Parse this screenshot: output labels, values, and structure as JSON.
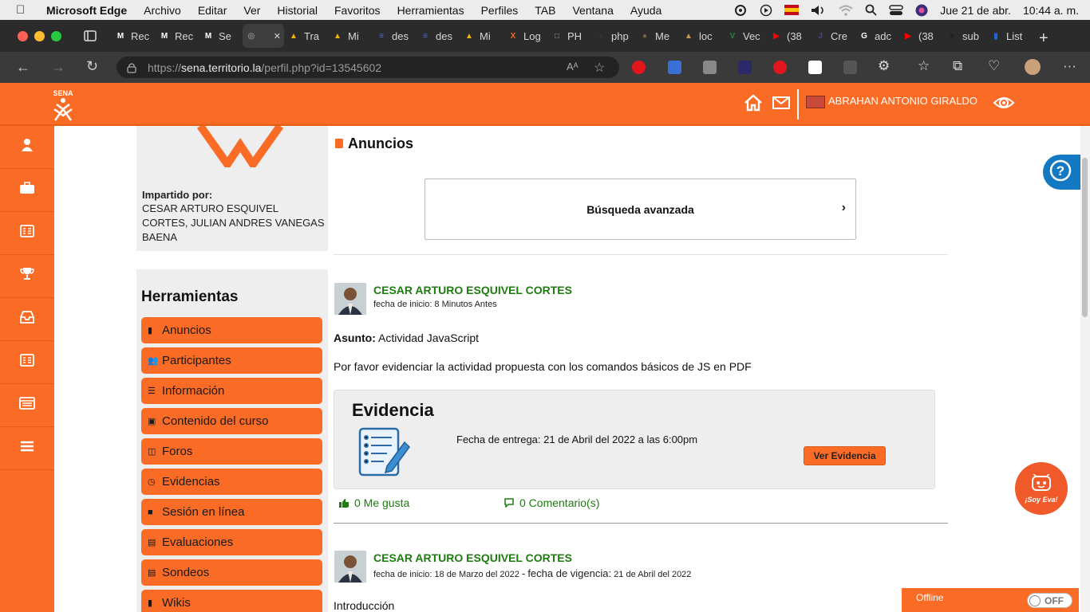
{
  "macbar": {
    "app": "Microsoft Edge",
    "menus": [
      "Archivo",
      "Editar",
      "Ver",
      "Historial",
      "Favoritos",
      "Herramientas",
      "Perfiles",
      "TAB",
      "Ventana",
      "Ayuda"
    ],
    "date": "Jue 21 de abr.",
    "time": "10:44 a. m."
  },
  "tabs": [
    {
      "label": "Rec",
      "color": "#ffffff",
      "glyph": "M"
    },
    {
      "label": "Rec",
      "color": "#ffffff",
      "glyph": "M"
    },
    {
      "label": "Se",
      "color": "#ffffff",
      "glyph": "M"
    },
    {
      "label": "",
      "color": "#888888",
      "glyph": "◎"
    },
    {
      "label": "Tra",
      "color": "#f4b400",
      "glyph": "▲"
    },
    {
      "label": "Mi",
      "color": "#f4b400",
      "glyph": "▲"
    },
    {
      "label": "des",
      "color": "#4a6fd6",
      "glyph": "≡"
    },
    {
      "label": "des",
      "color": "#4a6fd6",
      "glyph": "≡"
    },
    {
      "label": "Mi",
      "color": "#f4b400",
      "glyph": "▲"
    },
    {
      "label": "Log",
      "color": "#f26522",
      "glyph": "X"
    },
    {
      "label": "PH",
      "color": "#999999",
      "glyph": "□"
    },
    {
      "label": "php",
      "color": "#333333",
      "glyph": "●"
    },
    {
      "label": "Me",
      "color": "#776a43",
      "glyph": "●"
    },
    {
      "label": "loc",
      "color": "#c6a14a",
      "glyph": "▲"
    },
    {
      "label": "Vec",
      "color": "#2f7d3c",
      "glyph": "V"
    },
    {
      "label": "(38",
      "color": "#ff0000",
      "glyph": "▶"
    },
    {
      "label": "Cre",
      "color": "#5b3b8c",
      "glyph": "J"
    },
    {
      "label": "adc",
      "color": "#ffffff",
      "glyph": "G"
    },
    {
      "label": "(38",
      "color": "#ff0000",
      "glyph": "▶"
    },
    {
      "label": "sub",
      "color": "#222222",
      "glyph": "●"
    },
    {
      "label": "List",
      "color": "#1e64d6",
      "glyph": "▮"
    }
  ],
  "address": {
    "scheme": "https://",
    "host": "sena.territorio.la",
    "path": "/perfil.php?id=13545602"
  },
  "header": {
    "logo_text": "SENA",
    "user_name": "ABRAHAN ANTONIO GIRALDO"
  },
  "course": {
    "imparted_label": "Impartido por:",
    "imparted_names": [
      "CESAR ARTURO ESQUIVEL",
      "CORTES, JULIAN ANDRES VANEGAS",
      "BAENA"
    ]
  },
  "tools": {
    "title": "Herramientas",
    "items": [
      {
        "label": "Anuncios",
        "icon": "▮"
      },
      {
        "label": "Participantes",
        "icon": "👥"
      },
      {
        "label": "Información",
        "icon": "☰"
      },
      {
        "label": "Contenido del curso",
        "icon": "▣"
      },
      {
        "label": "Foros",
        "icon": "◫"
      },
      {
        "label": "Evidencias",
        "icon": "◷"
      },
      {
        "label": "Sesión en línea",
        "icon": "■"
      },
      {
        "label": "Evaluaciones",
        "icon": "▤"
      },
      {
        "label": "Sondeos",
        "icon": "▤"
      },
      {
        "label": "Wikis",
        "icon": "▮"
      }
    ]
  },
  "main": {
    "section_title": "Anuncios",
    "search_label": "Búsqueda avanzada"
  },
  "posts": [
    {
      "author": "CESAR ARTURO ESQUIVEL CORTES",
      "meta": "fecha de inicio: 8 Minutos Antes",
      "subject_label": "Asunto:",
      "subject": "Actividad JavaScript",
      "body": "Por favor evidenciar la actividad propuesta con los comandos básicos de JS en PDF",
      "evidence_title": "Evidencia",
      "due": "Fecha de entrega: 21 de Abril del 2022 a las 6:00pm",
      "button": "Ver Evidencia",
      "likes": "0 Me gusta",
      "comments": "0 Comentario(s)"
    },
    {
      "author": "CESAR ARTURO ESQUIVEL CORTES",
      "meta_start": "fecha de inicio: 18 de Marzo del 2022",
      "meta_sep": "-",
      "meta_validity_label": "fecha de vigencia:",
      "meta_validity": "21 de Abril del 2022",
      "body": "Introducción"
    }
  ],
  "widgets": {
    "eva": "¡Soy Eva!",
    "status": "Offline",
    "toggle": "OFF"
  },
  "colors": {
    "brand": "#fa6b25",
    "green": "#1e7b10",
    "help": "#1479c3"
  }
}
